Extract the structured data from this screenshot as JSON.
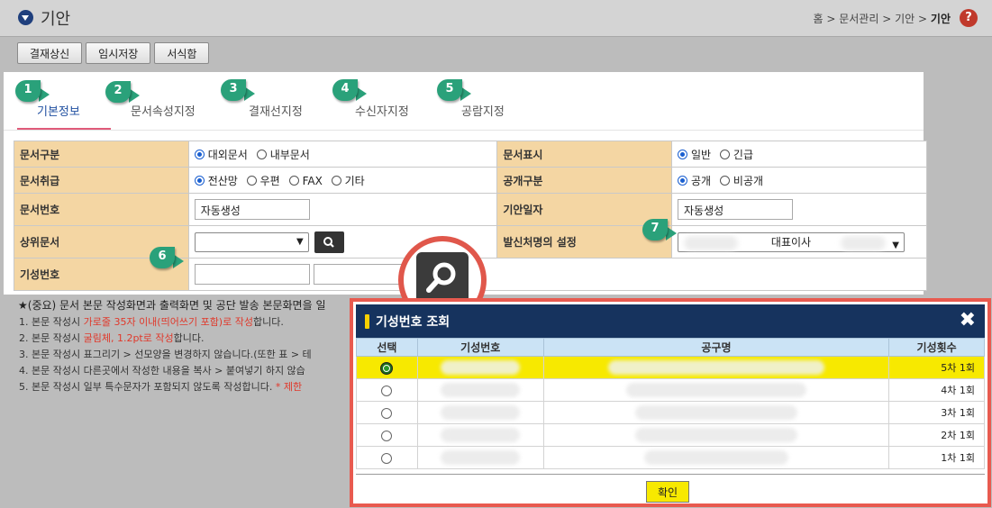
{
  "header": {
    "title": "기안",
    "breadcrumb": [
      "홈",
      "문서관리",
      "기안",
      "기안"
    ],
    "breadcrumb_sep": ">",
    "help_icon_glyph": "?"
  },
  "toolbar": {
    "submit_label": "결재상신",
    "save_label": "임시저장",
    "template_label": "서식함"
  },
  "tabs": [
    {
      "label": "기본정보",
      "badge": "1",
      "active": true
    },
    {
      "label": "문서속성지정",
      "badge": "2"
    },
    {
      "label": "결재선지정",
      "badge": "3"
    },
    {
      "label": "수신자지정",
      "badge": "4"
    },
    {
      "label": "공람지정",
      "badge": "5"
    }
  ],
  "form": {
    "doc_type_label": "문서구분",
    "doc_type_options": [
      "대외문서",
      "내부문서"
    ],
    "doc_display_label": "문서표시",
    "doc_display_options": [
      "일반",
      "긴급"
    ],
    "doc_handling_label": "문서취급",
    "doc_handling_options": [
      "전산망",
      "우편",
      "FAX",
      "기타"
    ],
    "disclosure_label": "공개구분",
    "disclosure_options": [
      "공개",
      "비공개"
    ],
    "doc_number_label": "문서번호",
    "doc_number_value": "자동생성",
    "draft_date_label": "기안일자",
    "draft_date_value": "자동생성",
    "parent_doc_label": "상위문서",
    "parent_doc_value": "",
    "sender_label": "발신처명의 설정",
    "sender_value": "대표이사",
    "sender_badge": "7",
    "period_no_label": "기성번호",
    "period_no_badge": "6"
  },
  "notes": {
    "head": "★(중요) 문서 본문 작성화면과 출력화면 및 공단 발송 본문화면을 일",
    "items": [
      {
        "pre": "1. 본문 작성시 ",
        "red": "가로줄 35자 이내(띄어쓰기 포함)로 작성",
        "post": "합니다."
      },
      {
        "pre": "2. 본문 작성시 ",
        "red": "굴림체, 1.2pt로 작성",
        "post": "합니다."
      },
      {
        "pre": "3. 본문 작성시 표그리기 > 선모양을 변경하지 않습니다.(또한 표 > 테",
        "red": "",
        "post": ""
      },
      {
        "pre": "4. 본문 작성시 다른곳에서 작성한 내용을 복사 > 붙여넣기 하지 않습",
        "red": "",
        "post": ""
      },
      {
        "pre": "5. 본문 작성시 일부 특수문자가 포함되지 않도록 작성합니다. ",
        "red": "* 제한",
        "post": ""
      }
    ]
  },
  "dialog": {
    "title": "기성번호 조회",
    "close_glyph": "✖",
    "columns": [
      "선택",
      "기성번호",
      "공구명",
      "기성횟수"
    ],
    "rows": [
      {
        "count": "5차 1회",
        "selected": true
      },
      {
        "count": "4차 1회"
      },
      {
        "count": "3차 1회"
      },
      {
        "count": "2차 1회"
      },
      {
        "count": "1차 1회"
      }
    ],
    "confirm_label": "확인"
  },
  "colors": {
    "accent_tab": "#e05a7a",
    "badge": "#2aa17a",
    "label_bg": "#f4d6a3",
    "dialog_header": "#16335e",
    "selected_row": "#f7e900",
    "highlight_border": "#e85a4f"
  }
}
